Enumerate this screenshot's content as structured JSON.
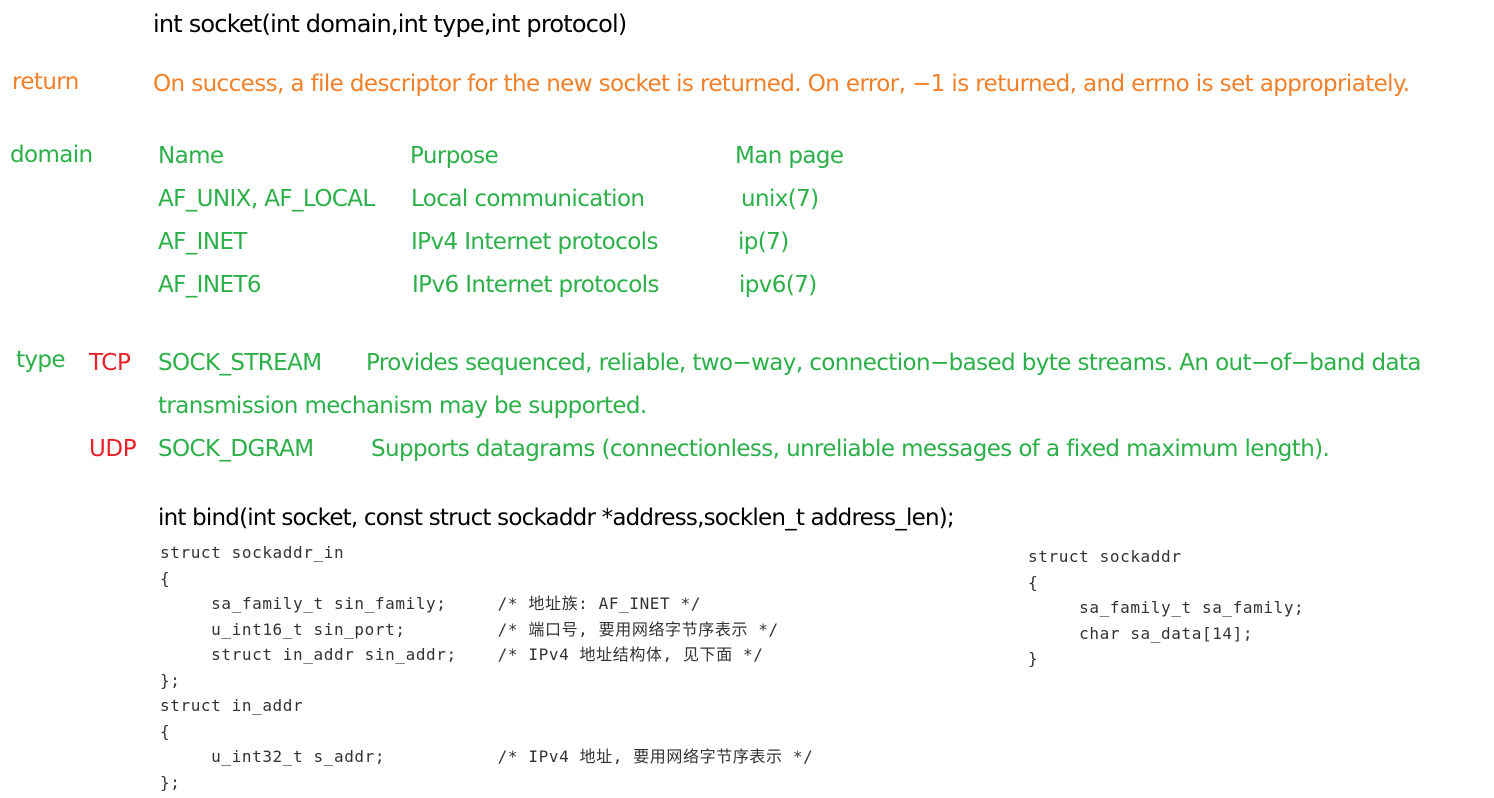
{
  "socket_signature": "int  socket(int domain,int type,int protocol)",
  "return_section": {
    "label": "return",
    "text": "On  success, a file descriptor for the new socket is returned.  On error, −1 is returned, and errno is set appropriately."
  },
  "domain_section": {
    "label": "domain",
    "headers": {
      "name": "Name",
      "purpose": "Purpose",
      "man_page": "Man page"
    },
    "rows": [
      {
        "name": "AF_UNIX, AF_LOCAL",
        "purpose": "Local communication",
        "man_page": "unix(7)"
      },
      {
        "name": "AF_INET",
        "purpose": "IPv4 Internet protocols",
        "man_page": "ip(7)"
      },
      {
        "name": "AF_INET6",
        "purpose": "IPv6 Internet protocols",
        "man_page": "ipv6(7)"
      }
    ]
  },
  "type_section": {
    "label": "type",
    "items": [
      {
        "protocol": "TCP",
        "name": "SOCK_STREAM",
        "desc_line1": "Provides sequenced, reliable, two−way, connection−based byte streams.   An out−of−band data",
        "desc_line2": "transmission mechanism may be supported."
      },
      {
        "protocol": "UDP",
        "name": "SOCK_DGRAM",
        "desc_line1": "Supports datagrams (connectionless, unreliable messages of a fixed maximum length)."
      }
    ]
  },
  "bind_signature": "int bind(int socket, const struct sockaddr *address,socklen_t address_len);",
  "code_sockaddr_in": [
    "struct sockaddr_in",
    "{",
    "     sa_family_t sin_family;     /* 地址族: AF_INET */",
    "     u_int16_t sin_port;         /* 端口号, 要用网络字节序表示 */",
    "     struct in_addr sin_addr;    /* IPv4 地址结构体, 见下面 */",
    "};",
    "struct in_addr",
    "{",
    "     u_int32_t s_addr;           /* IPv4 地址, 要用网络字节序表示 */",
    "};"
  ],
  "code_sockaddr": [
    "struct sockaddr",
    "{",
    "     sa_family_t sa_family;",
    "     char sa_data[14];",
    "}"
  ],
  "colors": {
    "orange": "#f0802a",
    "green": "#2db04a",
    "red": "#e8202a",
    "code": "#333333"
  }
}
